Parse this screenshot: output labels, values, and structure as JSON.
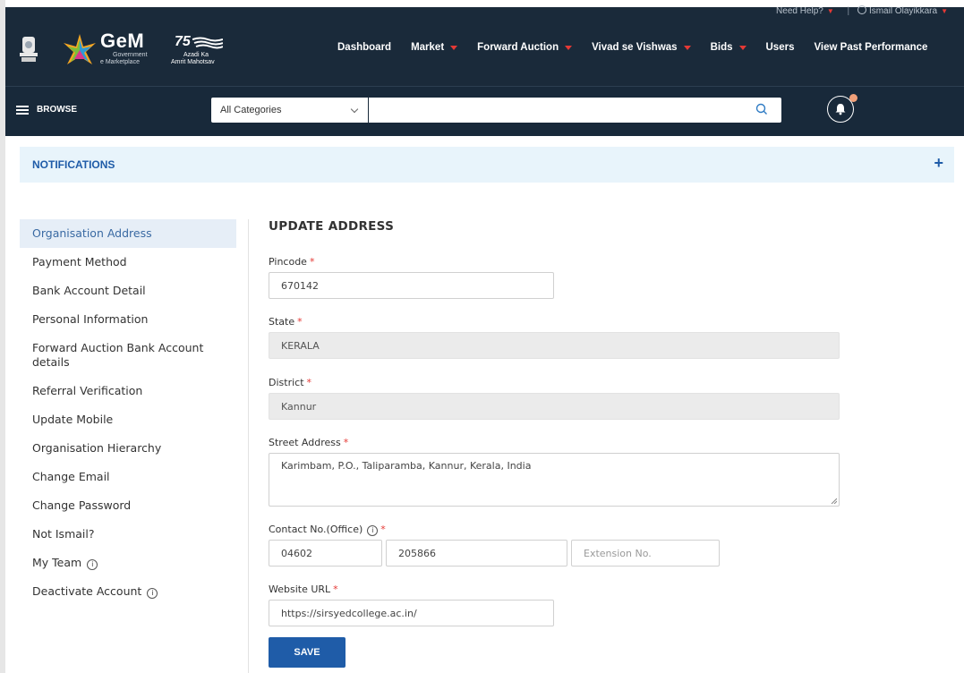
{
  "header": {
    "need_help": "Need Help?",
    "user_name": "Ismail Olayikkara",
    "logo_text": "GeM",
    "logo_sub1": "Government",
    "logo_sub2": "e Marketplace",
    "azadi_num": "75",
    "azadi_line1": "Azadi Ka",
    "azadi_line2": "Amrit Mahotsav",
    "nav": [
      {
        "label": "Dashboard",
        "has_dropdown": false
      },
      {
        "label": "Market",
        "has_dropdown": true
      },
      {
        "label": "Forward Auction",
        "has_dropdown": true
      },
      {
        "label": "Vivad se Vishwas",
        "has_dropdown": true
      },
      {
        "label": "Bids",
        "has_dropdown": true
      },
      {
        "label": "Users",
        "has_dropdown": false
      },
      {
        "label": "View Past Performance",
        "has_dropdown": false
      }
    ]
  },
  "searchbar": {
    "browse_label": "BROWSE",
    "category_selected": "All Categories",
    "search_placeholder": ""
  },
  "notifications": {
    "title": "NOTIFICATIONS",
    "expand_symbol": "+"
  },
  "sidebar": {
    "items": [
      {
        "label": "Organisation Address",
        "active": true
      },
      {
        "label": "Payment Method"
      },
      {
        "label": "Bank Account Detail"
      },
      {
        "label": "Personal Information"
      },
      {
        "label": "Forward Auction Bank Account details"
      },
      {
        "label": "Referral Verification"
      },
      {
        "label": "Update Mobile"
      },
      {
        "label": "Organisation Hierarchy"
      },
      {
        "label": "Change Email"
      },
      {
        "label": "Change Password"
      },
      {
        "label": "Not Ismail?"
      },
      {
        "label": "My Team",
        "info": true
      },
      {
        "label": "Deactivate Account",
        "info": true
      }
    ]
  },
  "form": {
    "title": "UPDATE ADDRESS",
    "pincode_label": "Pincode",
    "pincode_value": "670142",
    "state_label": "State",
    "state_value": "KERALA",
    "district_label": "District",
    "district_value": "Kannur",
    "street_label": "Street Address",
    "street_value": "Karimbam, P.O., Taliparamba, Kannur, Kerala, India",
    "contact_label": "Contact No.(Office)",
    "contact_std": "04602",
    "contact_number": "205866",
    "contact_ext_placeholder": "Extension No.",
    "website_label": "Website URL",
    "website_value": "https://sirsyedcollege.ac.in/",
    "required_mark": "*",
    "save_label": "SAVE"
  },
  "colors": {
    "header_bg": "#1a2a3a",
    "accent": "#1f5ca8",
    "required": "#e53935",
    "notification_bg": "#e8f4fb"
  }
}
